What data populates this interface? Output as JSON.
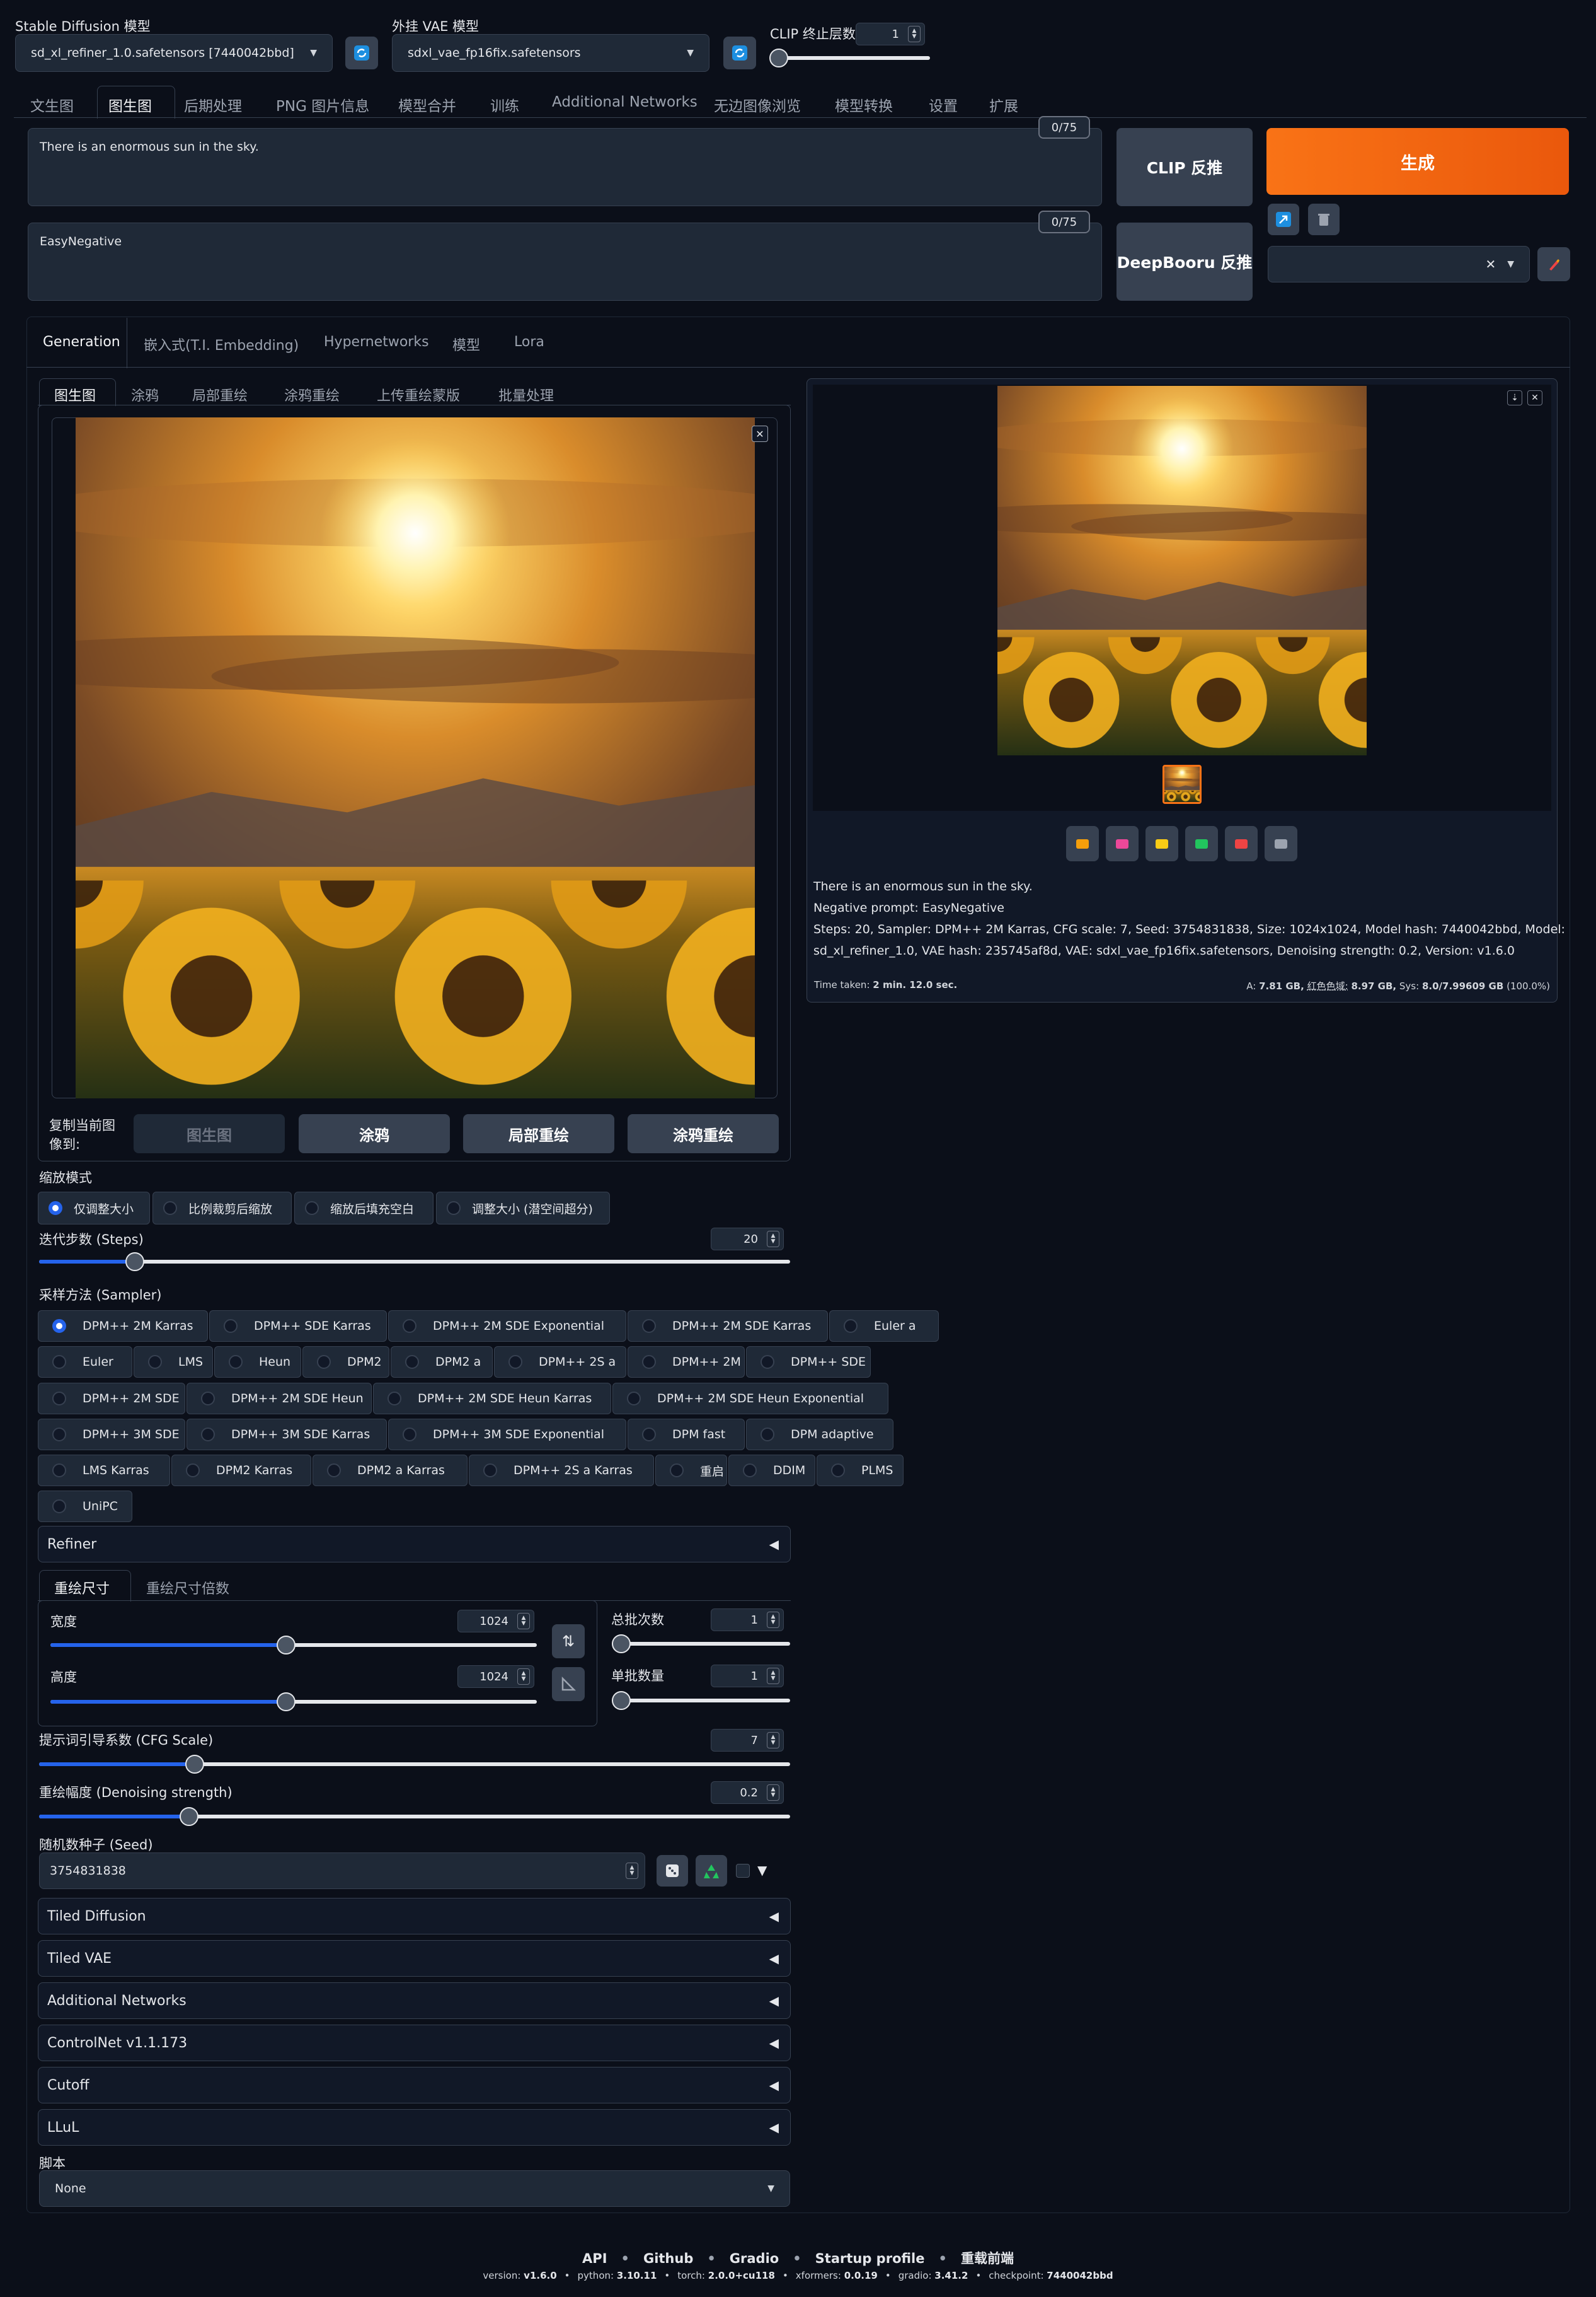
{
  "top": {
    "sd_model_label": "Stable Diffusion 模型",
    "sd_model_value": "sd_xl_refiner_1.0.safetensors [7440042bbd]",
    "vae_label": "外挂 VAE 模型",
    "vae_value": "sdxl_vae_fp16fix.safetensors",
    "clip_label": "CLIP 终止层数",
    "clip_value": "1",
    "clip_slider_fraction": 0.0
  },
  "main_tabs": [
    "文生图",
    "图生图",
    "后期处理",
    "PNG 图片信息",
    "模型合并",
    "训练",
    "Additional Networks",
    "无边图像浏览",
    "模型转换",
    "设置",
    "扩展"
  ],
  "main_tab_active": "图生图",
  "prompt": {
    "positive": "There is an enormous sun in the sky.",
    "positive_count": "0/75",
    "negative": "EasyNegative",
    "negative_count": "0/75",
    "clip_btn": "CLIP 反推",
    "deepbooru_btn": "DeepBooru 反推",
    "generate_btn": "生成"
  },
  "extra_tabs": [
    "Generation",
    "嵌入式(T.I. Embedding)",
    "Hypernetworks",
    "模型",
    "Lora"
  ],
  "sub_tabs": [
    "图生图",
    "涂鸦",
    "局部重绘",
    "涂鸦重绘",
    "上传重绘蒙版",
    "批量处理"
  ],
  "copy_to": {
    "label": "复制当前图像到:",
    "buttons": [
      "图生图",
      "涂鸦",
      "局部重绘",
      "涂鸦重绘"
    ]
  },
  "resize_mode": {
    "label": "缩放模式",
    "options": [
      "仅调整大小",
      "比例裁剪后缩放",
      "缩放后填充空白",
      "调整大小 (潜空间超分)"
    ],
    "selected": 0
  },
  "steps": {
    "label": "迭代步数 (Steps)",
    "value": "20",
    "min": 1,
    "max": 150
  },
  "sampler": {
    "label": "采样方法 (Sampler)",
    "rows": [
      [
        "DPM++ 2M Karras",
        "DPM++ SDE Karras",
        "DPM++ 2M SDE Exponential",
        "DPM++ 2M SDE Karras",
        "Euler a"
      ],
      [
        "Euler",
        "LMS",
        "Heun",
        "DPM2",
        "DPM2 a",
        "DPM++ 2S a",
        "DPM++ 2M",
        "DPM++ SDE"
      ],
      [
        "DPM++ 2M SDE",
        "DPM++ 2M SDE Heun",
        "DPM++ 2M SDE Heun Karras",
        "DPM++ 2M SDE Heun Exponential"
      ],
      [
        "DPM++ 3M SDE",
        "DPM++ 3M SDE Karras",
        "DPM++ 3M SDE Exponential",
        "DPM fast",
        "DPM adaptive"
      ],
      [
        "LMS Karras",
        "DPM2 Karras",
        "DPM2 a Karras",
        "DPM++ 2S a Karras",
        "重启",
        "DDIM",
        "PLMS"
      ],
      [
        "UniPC"
      ]
    ],
    "selected": "DPM++ 2M Karras"
  },
  "refiner_label": "Refiner",
  "size_tabs": [
    "重绘尺寸",
    "重绘尺寸倍数"
  ],
  "width": {
    "label": "宽度",
    "value": "1024",
    "min": 64,
    "max": 2048
  },
  "height": {
    "label": "高度",
    "value": "1024",
    "min": 64,
    "max": 2048
  },
  "batch_count": {
    "label": "总批次数",
    "value": "1",
    "min": 1,
    "max": 100
  },
  "batch_size": {
    "label": "单批数量",
    "value": "1",
    "min": 1,
    "max": 8
  },
  "cfg": {
    "label": "提示词引导系数 (CFG Scale)",
    "value": "7",
    "min": 1,
    "max": 30
  },
  "denoise": {
    "label": "重绘幅度 (Denoising strength)",
    "value": "0.2",
    "min": 0,
    "max": 1
  },
  "seed": {
    "label": "随机数种子 (Seed)",
    "value": "3754831838"
  },
  "accordions": [
    "Tiled Diffusion",
    "Tiled VAE",
    "Additional Networks",
    "ControlNet v1.1.173",
    "Cutoff",
    "LLuL"
  ],
  "script": {
    "label": "脚本",
    "value": "None"
  },
  "output": {
    "info_lines": [
      "There is an enormous sun in the sky.",
      "Negative prompt: EasyNegative",
      "Steps: 20, Sampler: DPM++ 2M Karras, CFG scale: 7, Seed: 3754831838, Size: 1024x1024, Model hash: 7440042bbd, Model:",
      "sd_xl_refiner_1.0, VAE hash: 235745af8d, VAE: sdxl_vae_fp16fix.safetensors, Denoising strength: 0.2, Version: v1.6.0"
    ],
    "time_label": "Time taken:",
    "time_value": "2 min. 12.0 sec.",
    "mem_a_label": "A:",
    "mem_a_value": "7.81 GB,",
    "mem_r_label": "红色色域:",
    "mem_r_value": "8.97 GB,",
    "mem_sys_label": "Sys:",
    "mem_sys_value": "8.0/7.99609 GB",
    "mem_pct": "(100.0%)"
  },
  "footer": {
    "links": [
      "API",
      "Github",
      "Gradio",
      "Startup profile",
      "重载前端"
    ],
    "sep": "•",
    "versions": [
      {
        "k": "version:",
        "v": "v1.6.0"
      },
      {
        "k": "python:",
        "v": "3.10.11"
      },
      {
        "k": "torch:",
        "v": "2.0.0+cu118"
      },
      {
        "k": "xformers:",
        "v": "0.0.19"
      },
      {
        "k": "gradio:",
        "v": "3.41.2"
      },
      {
        "k": "checkpoint:",
        "v": "7440042bbd"
      }
    ]
  },
  "colors": {
    "accent": "#2563eb",
    "generate": "#ea580c",
    "bg": "#0b0f19"
  }
}
